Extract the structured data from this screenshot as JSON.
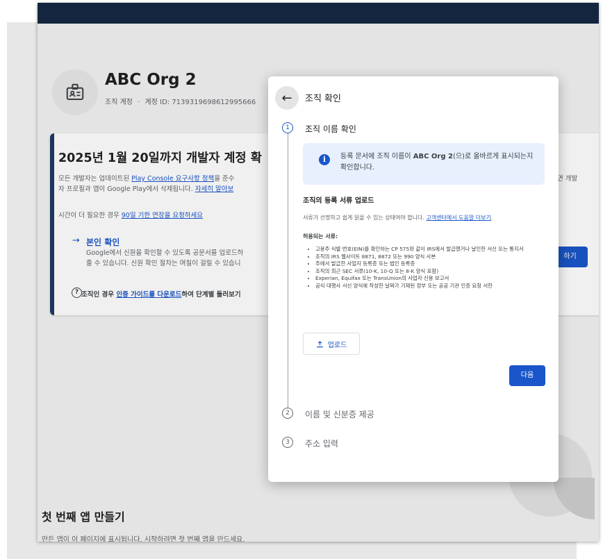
{
  "org": {
    "name": "ABC Org 2",
    "account_type": "조직 계정",
    "separator": "·",
    "account_id": "계정 ID: 7139319698612995666"
  },
  "banner": {
    "title": "2025년 1월 20일까지 개발자 계정 확",
    "line1_prefix": "모든 개발자는 업데이트된 ",
    "line1_link": "Play Console 요구사항 정책",
    "line1_suffix": "을 준수",
    "line2_prefix": "자 프로필과 앱이 Google Play에서 삭제됩니다. ",
    "line2_link": "자세히 알아보",
    "extension_prefix": "시간이 더 필요한 경우 ",
    "extension_link": "90일 기한 연장을 요청하세요",
    "verify_title": "본인 확인",
    "verify_line1": "Google에서 신원을 확인할 수 있도록 공문서를 업로드하",
    "verify_line2": "줄 수 있습니다. 신원 확인 절차는 며칠이 걸릴 수 있습니",
    "download_prefix": "조직인 경우 ",
    "download_link": "인증 가이드를 다운로드",
    "download_suffix": "하여 단계별 둘러보기",
    "right_text": "면 개발",
    "right_button": "하기"
  },
  "first_app": {
    "title": "첫 번째 앱 만들기",
    "desc": "만든 앱이 이 페이지에 표시됩니다. 시작하려면 첫 번째 앱을 만드세요."
  },
  "dialog": {
    "title": "조직 확인",
    "steps": [
      {
        "num": "1",
        "label": "조직 이름 확인"
      },
      {
        "num": "2",
        "label": "이름 및 신분증 제공"
      },
      {
        "num": "3",
        "label": "주소 입력"
      }
    ],
    "info_prefix": "등록 문서에 조직 이름이 ",
    "info_bold": "ABC Org 2",
    "info_suffix": "(으)로 올바르게 표시되는지 확인합니다.",
    "upload_heading": "조직의 등록 서류 업로드",
    "upload_desc_prefix": "서류가 선명하고 쉽게 읽을 수 있는 상태여야 합니다. ",
    "upload_desc_link": "고객센터에서 도움말 더보기",
    "upload_desc_suffix": ".",
    "allowed_label": "허용되는 서류:",
    "documents": [
      "고용주 식별 번호(EIN)를 확인하는 CP 575와 같이 IRS에서 발급했거나 날인한 서신 또는 통지서",
      "조직의 IRS 웹사이트 8871, 8872 또는 990 양식 사본",
      "주에서 발급한 사업자 등록증 또는 법인 등록증",
      "조직의 최근 SEC 서류(10-K, 10-Q 또는 8-K 양식 포함)",
      "Experian, Equifax 또는 TransUnion의 사업자 신용 보고서",
      "공식 대행사 서신 양식에 작성한 날짜가 기재된 정부 또는 공공 기관 인증 요청 서한"
    ],
    "upload_button": "업로드",
    "next_button": "다음"
  }
}
